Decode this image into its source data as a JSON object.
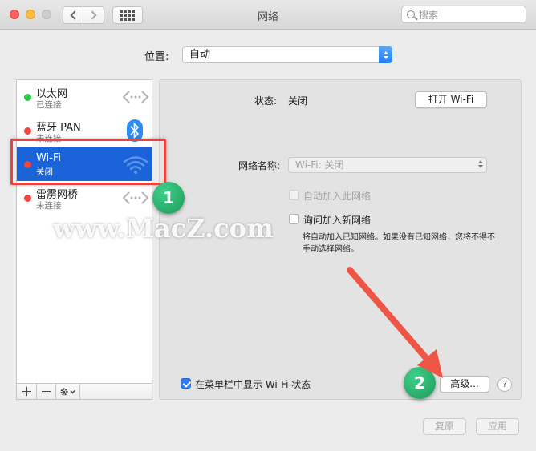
{
  "window": {
    "title": "网络"
  },
  "search": {
    "placeholder": "搜索"
  },
  "location": {
    "label": "位置:",
    "value": "自动"
  },
  "services": [
    {
      "name": "以太网",
      "status": "已连接",
      "status_color": "#28c840"
    },
    {
      "name": "蓝牙 PAN",
      "status": "未连接",
      "status_color": "#f0463e"
    },
    {
      "name": "Wi-Fi",
      "status": "关闭",
      "status_color": "#f0463e"
    },
    {
      "name": "雷雳网桥",
      "status": "未连接",
      "status_color": "#f0463e"
    }
  ],
  "panel": {
    "status_label": "状态:",
    "status_value": "关闭",
    "toggle_button": "打开 Wi-Fi",
    "network_name_label": "网络名称:",
    "network_name_value": "Wi-Fi: 关闭",
    "auto_join_label": "自动加入此网络",
    "ask_join_label": "询问加入新网络",
    "ask_join_note": "将自动加入已知网络。如果没有已知网络，您将不得不手动选择网络。",
    "show_in_menubar_label": "在菜单栏中显示 Wi-Fi 状态",
    "advanced_button": "高级...",
    "help_button": "?"
  },
  "footer": {
    "revert_button": "复原",
    "apply_button": "应用"
  },
  "annotations": {
    "badge_1": "1",
    "badge_2": "2",
    "watermark": "www.MacZ.com"
  },
  "colors": {
    "selection": "#1b63d8",
    "accent": "#2f7df3",
    "annotation_red": "#e8463d",
    "badge_green": "#27b06a"
  }
}
